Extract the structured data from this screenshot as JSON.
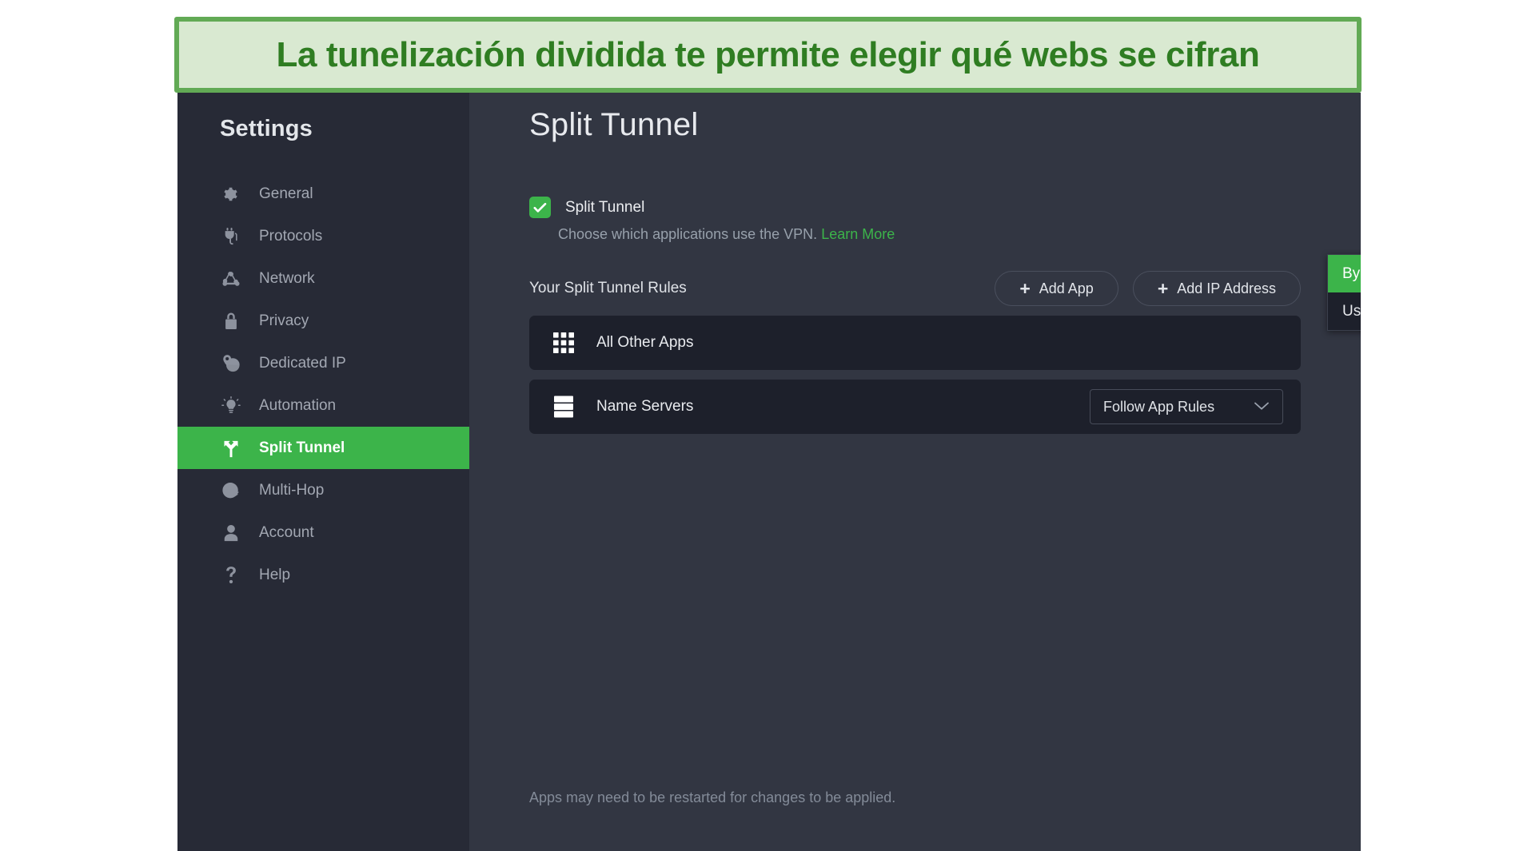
{
  "banner": {
    "text": "La tunelización dividida te permite elegir qué webs se cifran",
    "bg": "#d9e9d1",
    "border_color": "#62aa55",
    "text_color": "#2f7d22"
  },
  "theme": {
    "accent_green": "#3cb44a",
    "sidebar_bg": "#272a36",
    "content_bg": "#323642",
    "card_bg": "#1d202b"
  },
  "sidebar": {
    "title": "Settings",
    "items": [
      {
        "label": "General",
        "icon": "gear-icon",
        "active": false
      },
      {
        "label": "Protocols",
        "icon": "plug-icon",
        "active": false
      },
      {
        "label": "Network",
        "icon": "network-nodes-icon",
        "active": false
      },
      {
        "label": "Privacy",
        "icon": "lock-icon",
        "active": false
      },
      {
        "label": "Dedicated IP",
        "icon": "pin-globe-icon",
        "active": false
      },
      {
        "label": "Automation",
        "icon": "lightbulb-icon",
        "active": false
      },
      {
        "label": "Split Tunnel",
        "icon": "split-fork-icon",
        "active": true
      },
      {
        "label": "Multi-Hop",
        "icon": "globe-hop-icon",
        "active": false
      },
      {
        "label": "Account",
        "icon": "person-icon",
        "active": false
      },
      {
        "label": "Help",
        "icon": "question-mark-icon",
        "active": false
      }
    ]
  },
  "main": {
    "page_title": "Split Tunnel",
    "toggle": {
      "label": "Split Tunnel",
      "checked": true
    },
    "description": {
      "text": "Choose which applications use the VPN.",
      "link_text": "Learn More"
    },
    "rules": {
      "label": "Your Split Tunnel Rules",
      "buttons": [
        {
          "label": "Add App",
          "icon": "plus-icon"
        },
        {
          "label": "Add IP Address",
          "icon": "plus-icon"
        }
      ],
      "rows": [
        {
          "name": "All Other Apps",
          "icon": "apps-grid-icon",
          "selected_value": "Bypass VPN",
          "menu_open": true
        },
        {
          "name": "Name Servers",
          "icon": "server-rack-icon",
          "selected_value": "Follow App Rules",
          "menu_open": false
        }
      ]
    },
    "open_menu": {
      "options": [
        {
          "label": "Bypass VPN",
          "selected": true
        },
        {
          "label": "Use VPN",
          "selected": false
        }
      ]
    },
    "footer_note": "Apps may need to be restarted for changes to be applied."
  }
}
